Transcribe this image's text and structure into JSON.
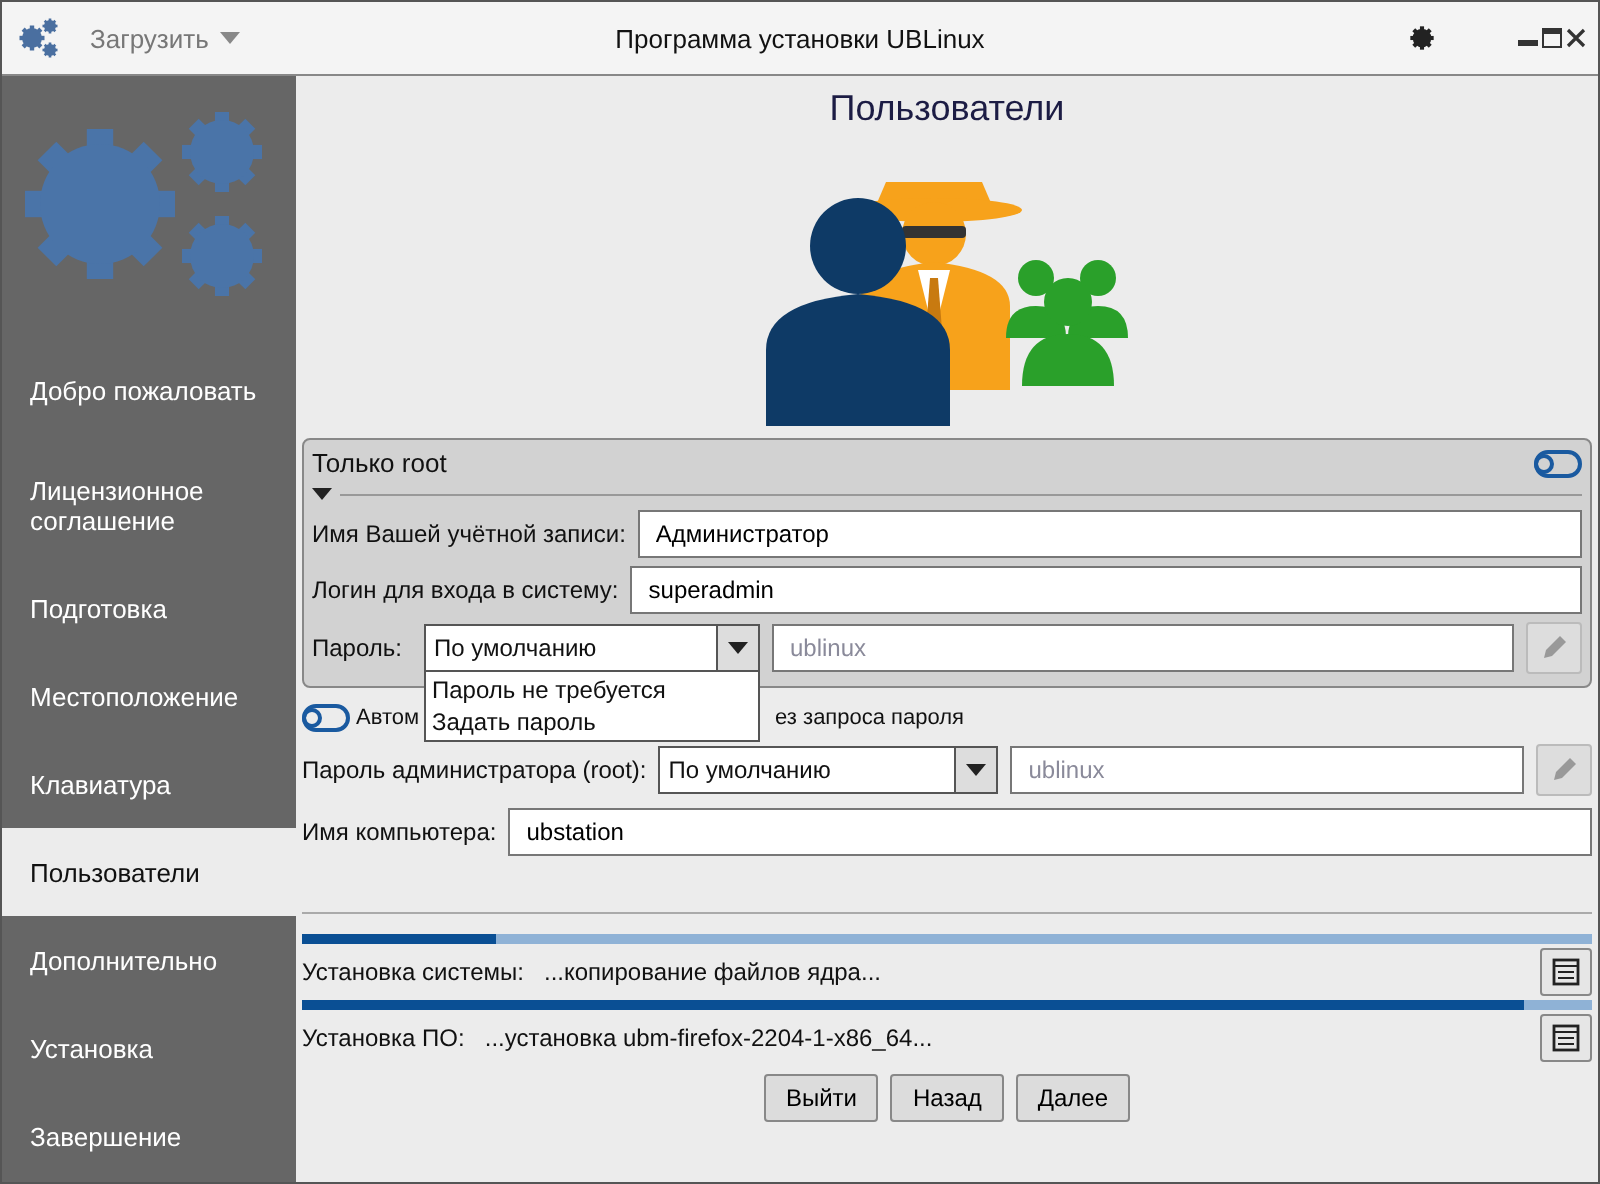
{
  "window": {
    "title": "Программа установки UBLinux",
    "menu": "Загрузить"
  },
  "sidebar": {
    "items": [
      {
        "label": "Добро пожаловать",
        "selected": false
      },
      {
        "label": "Лицензионное соглашение",
        "selected": false
      },
      {
        "label": "Подготовка",
        "selected": false
      },
      {
        "label": "Местоположение",
        "selected": false
      },
      {
        "label": "Клавиатура",
        "selected": false
      },
      {
        "label": "Пользователи",
        "selected": true
      },
      {
        "label": "Дополнительно",
        "selected": false
      },
      {
        "label": "Установка",
        "selected": false
      },
      {
        "label": "Завершение",
        "selected": false
      }
    ]
  },
  "page": {
    "title": "Пользователи"
  },
  "root_only": {
    "label": "Только root",
    "on": false,
    "account_name": {
      "label": "Имя Вашей учётной записи:",
      "value": "Администратор"
    },
    "login": {
      "label": "Логин для входа в систему:",
      "value": "superadmin"
    },
    "password": {
      "label": "Пароль:",
      "mode": "По умолчанию",
      "placeholder": "ublinux",
      "options": [
        "Пароль не требуется",
        "Задать пароль"
      ]
    }
  },
  "autologin": {
    "label_start": "Автом",
    "label_end": "ез запроса пароля",
    "on": false
  },
  "root_password": {
    "label": "Пароль администратора (root):",
    "mode": "По умолчанию",
    "placeholder": "ublinux"
  },
  "hostname": {
    "label": "Имя компьютера:",
    "value": "ubstation"
  },
  "progress": [
    {
      "label": "Установка системы:",
      "status": "...копирование файлов ядра...",
      "level": 0.15
    },
    {
      "label": "Установка ПО:",
      "status": "...установка ubm-firefox-2204-1-x86_64...",
      "level": 0.947
    }
  ],
  "buttons": [
    "Выйти",
    "Назад",
    "Далее"
  ]
}
